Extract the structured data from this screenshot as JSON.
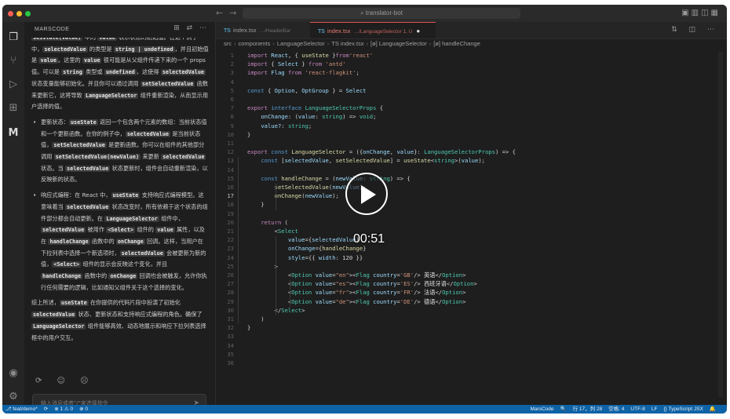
{
  "window": {
    "search_text": "⌕ translator-bot",
    "traffic_lights": [
      "#ff5f57",
      "#febc2e",
      "#28c840"
    ]
  },
  "chat": {
    "panel_title": "MARSCODE",
    "header_icons": "⊞ ⇄ ⋯",
    "paragraphs": {
      "p1": [
        {
          "t": "text",
          "v": ""
        },
        {
          "t": "code",
          "v": "sesstate(value)"
        },
        {
          "t": "text",
          "v": " 中的 "
        },
        {
          "t": "code",
          "v": "value"
        },
        {
          "t": "text",
          "v": " 表示状态的初始值。在这个例子中，"
        },
        {
          "t": "code",
          "v": "selectedValue"
        },
        {
          "t": "text",
          "v": " 的类型是 "
        },
        {
          "t": "code",
          "v": "string | undefined"
        },
        {
          "t": "text",
          "v": "，并且初始值是 "
        },
        {
          "t": "code",
          "v": "value"
        },
        {
          "t": "text",
          "v": "。这里的 "
        },
        {
          "t": "code",
          "v": "value"
        },
        {
          "t": "text",
          "v": " 很可能是从父组件传递下来的一个 props 值。可以是 "
        },
        {
          "t": "code",
          "v": "string"
        },
        {
          "t": "text",
          "v": " 类型或 "
        },
        {
          "t": "code",
          "v": "undefined"
        },
        {
          "t": "text",
          "v": "，这使得 "
        },
        {
          "t": "code",
          "v": "selectedValue"
        },
        {
          "t": "text",
          "v": " 状态变量能够初始化。并且你可以通过调用 "
        },
        {
          "t": "code",
          "v": "setSelectedValue"
        },
        {
          "t": "text",
          "v": " 函数来更新它，这将导致 "
        },
        {
          "t": "code",
          "v": "LanguageSelector"
        },
        {
          "t": "text",
          "v": " 组件重新渲染，从而显示用户选择的值。"
        }
      ],
      "bullet1": [
        {
          "t": "text",
          "v": "更新状态："
        },
        {
          "t": "code",
          "v": "useState"
        },
        {
          "t": "text",
          "v": " 返回一个包含两个元素的数组：当前状态值和一个更新函数。在你的例子中，"
        },
        {
          "t": "code",
          "v": "selectedValue"
        },
        {
          "t": "text",
          "v": " 是当前状态值，"
        },
        {
          "t": "code",
          "v": "setSelectedValue"
        },
        {
          "t": "text",
          "v": " 是更新函数。你可以在组件的其他部分调用 "
        },
        {
          "t": "code",
          "v": "setSelectedValue(newValue)"
        },
        {
          "t": "text",
          "v": " 来更新 "
        },
        {
          "t": "code",
          "v": "selectedValue"
        },
        {
          "t": "text",
          "v": " 状态。当 "
        },
        {
          "t": "code",
          "v": "selectedValue"
        },
        {
          "t": "text",
          "v": " 状态更新时，组件会自动重新渲染，以反映新的状态。"
        }
      ],
      "bullet2": [
        {
          "t": "text",
          "v": "响应式编程：在 React 中，"
        },
        {
          "t": "code",
          "v": "useState"
        },
        {
          "t": "text",
          "v": " 支持响应式编程模型。这意味着当 "
        },
        {
          "t": "code",
          "v": "selectedValue"
        },
        {
          "t": "text",
          "v": " 状态改变时，所有依赖于这个状态的组件部分都会自动更新。在 "
        },
        {
          "t": "code",
          "v": "LanguageSelector"
        },
        {
          "t": "text",
          "v": " 组件中，"
        },
        {
          "t": "code",
          "v": "selectedValue"
        },
        {
          "t": "text",
          "v": " 被用作 "
        },
        {
          "t": "code",
          "v": "<Select>"
        },
        {
          "t": "text",
          "v": " 组件的 "
        },
        {
          "t": "code",
          "v": "value"
        },
        {
          "t": "text",
          "v": " 属性，以及在 "
        },
        {
          "t": "code",
          "v": "handleChange"
        },
        {
          "t": "text",
          "v": " 函数中的 "
        },
        {
          "t": "code",
          "v": "onChange"
        },
        {
          "t": "text",
          "v": " 回调。这样，当用户在下拉列表中选择一个新选项时，"
        },
        {
          "t": "code",
          "v": "selectedValue"
        },
        {
          "t": "text",
          "v": " 会被更新为新的值，"
        },
        {
          "t": "code",
          "v": "<Select>"
        },
        {
          "t": "text",
          "v": " 组件的显示会反映这个变化，并且 "
        },
        {
          "t": "code",
          "v": "handleChange"
        },
        {
          "t": "text",
          "v": " 函数中的 "
        },
        {
          "t": "code",
          "v": "onChange"
        },
        {
          "t": "text",
          "v": " 回调也会被触发，允许你执行任何需要的逻辑，比如通知父组件关于这个选择的变化。"
        }
      ],
      "p2": [
        {
          "t": "text",
          "v": "综上所述，"
        },
        {
          "t": "code",
          "v": "useState"
        },
        {
          "t": "text",
          "v": " 在你提供的代码片段中扮演了初始化 "
        },
        {
          "t": "code",
          "v": "selectedValue"
        },
        {
          "t": "text",
          "v": " 状态、更新状态和支持响应式编程的角色。确保了 "
        },
        {
          "t": "code",
          "v": "LanguageSelector"
        },
        {
          "t": "text",
          "v": " 组件能够高效、动态地展示和响应下拉列表选择框中的用户交互。"
        }
      ]
    },
    "actions": "⟳ ☺ ☹",
    "input_placeholder": "输入消息或者\"/\"来选择指令",
    "send_icon": "➤"
  },
  "editor": {
    "tabs": [
      {
        "ext": "TS",
        "name": "index.tsx",
        "path": "…/HeaderBar",
        "active": false
      },
      {
        "ext": "TS",
        "name": "index.tsx",
        "path": "…/LanguageSelector 1, U",
        "active": true,
        "modified": "●"
      }
    ],
    "tab_icons": "⇅ ◫ ⋯",
    "breadcrumbs": [
      "src",
      "components",
      "LanguageSelector",
      "TS index.tsx",
      "[ø] LanguageSelector",
      "[ø] handleChange"
    ],
    "lines": [
      {
        "n": "1",
        "s": [
          [
            "kw2",
            "import "
          ],
          [
            "va",
            "React"
          ],
          [
            "pu",
            ", { "
          ],
          [
            "fn",
            "useState"
          ],
          [
            "pu",
            " }"
          ],
          [
            "kw2",
            "from"
          ],
          [
            "str",
            "'react'"
          ]
        ]
      },
      {
        "n": "2",
        "s": [
          [
            "kw2",
            "import "
          ],
          [
            "pu",
            "{ "
          ],
          [
            "va",
            "Select"
          ],
          [
            "pu",
            " } "
          ],
          [
            "kw2",
            "from "
          ],
          [
            "str",
            "'antd'"
          ]
        ]
      },
      {
        "n": "3",
        "s": [
          [
            "kw2",
            "import "
          ],
          [
            "va",
            "Flag "
          ],
          [
            "kw2",
            "from "
          ],
          [
            "str",
            "'react-flagkit'"
          ],
          [
            "pu",
            ";"
          ]
        ]
      },
      {
        "n": "4",
        "s": []
      },
      {
        "n": "5",
        "s": [
          [
            "kw",
            "const "
          ],
          [
            "pu",
            "{ "
          ],
          [
            "va",
            "Option"
          ],
          [
            "pu",
            ", "
          ],
          [
            "va",
            "OptGroup"
          ],
          [
            "pu",
            " } = "
          ],
          [
            "va",
            "Select"
          ]
        ]
      },
      {
        "n": "6",
        "s": []
      },
      {
        "n": "7",
        "s": [
          [
            "kw2",
            "export "
          ],
          [
            "kw",
            "interface "
          ],
          [
            "ty",
            "LanguageSelectorProps"
          ],
          [
            "pu",
            " {"
          ]
        ]
      },
      {
        "n": "8",
        "s": [
          [
            "pu",
            "    "
          ],
          [
            "va",
            "onChange"
          ],
          [
            "pu",
            ": ("
          ],
          [
            "va",
            "value"
          ],
          [
            "pu",
            ": "
          ],
          [
            "ty",
            "string"
          ],
          [
            "pu",
            ") => "
          ],
          [
            "ty",
            "void"
          ],
          [
            "pu",
            ";"
          ]
        ]
      },
      {
        "n": "9",
        "s": [
          [
            "pu",
            "    "
          ],
          [
            "va",
            "value?"
          ],
          [
            "pu",
            ": "
          ],
          [
            "ty",
            "string"
          ],
          [
            "pu",
            ";"
          ]
        ]
      },
      {
        "n": "10",
        "s": [
          [
            "pu",
            "}"
          ]
        ]
      },
      {
        "n": "11",
        "s": []
      },
      {
        "n": "12",
        "s": [
          [
            "kw2",
            "export "
          ],
          [
            "kw",
            "const "
          ],
          [
            "fn",
            "LanguageSelector"
          ],
          [
            "pu",
            " = ({"
          ],
          [
            "va",
            "onChange"
          ],
          [
            "pu",
            ", "
          ],
          [
            "va",
            "value"
          ],
          [
            "pu",
            "}: "
          ],
          [
            "ty",
            "LanguageSelectorProps"
          ],
          [
            "pu",
            ") => {"
          ]
        ]
      },
      {
        "n": "13",
        "s": [
          [
            "pu",
            "    "
          ],
          [
            "kw",
            "const "
          ],
          [
            "pu",
            "["
          ],
          [
            "va",
            "selectedValue"
          ],
          [
            "pu",
            ", "
          ],
          [
            "fn",
            "setSelectedValue"
          ],
          [
            "pu",
            "] = "
          ],
          [
            "fn",
            "useState"
          ],
          [
            "pu",
            "<"
          ],
          [
            "ty",
            "string"
          ],
          [
            "pu",
            ">("
          ],
          [
            "va",
            "value"
          ],
          [
            "pu",
            ");"
          ]
        ]
      },
      {
        "n": "14",
        "s": []
      },
      {
        "n": "15",
        "s": [
          [
            "pu",
            "    "
          ],
          [
            "kw",
            "const "
          ],
          [
            "fn",
            "handleChange"
          ],
          [
            "pu",
            " = ("
          ],
          [
            "va",
            "newValue"
          ],
          [
            "pu",
            ": "
          ],
          [
            "ty",
            "string"
          ],
          [
            "pu",
            ") => {"
          ]
        ]
      },
      {
        "n": "16",
        "s": [
          [
            "pu",
            "        "
          ],
          [
            "fn",
            "setSelectedValue"
          ],
          [
            "pu",
            "("
          ],
          [
            "va",
            "newValue"
          ],
          [
            "pu",
            ");"
          ]
        ]
      },
      {
        "n": "17",
        "s": [
          [
            "pu",
            "        "
          ],
          [
            "fn",
            "onChange"
          ],
          [
            "pu",
            "("
          ],
          [
            "va",
            "newValue"
          ],
          [
            "pu",
            ");"
          ]
        ]
      },
      {
        "n": "18",
        "s": [
          [
            "pu",
            "    }"
          ]
        ]
      },
      {
        "n": "19",
        "s": []
      },
      {
        "n": "20",
        "s": [
          [
            "pu",
            "    "
          ],
          [
            "kw2",
            "return "
          ],
          [
            "pu",
            "("
          ]
        ]
      },
      {
        "n": "21",
        "s": [
          [
            "pu",
            "        <"
          ],
          [
            "ty",
            "Select"
          ]
        ]
      },
      {
        "n": "22",
        "s": [
          [
            "pu",
            "            "
          ],
          [
            "at",
            "value"
          ],
          [
            "pu",
            "={"
          ],
          [
            "va",
            "selectedValue"
          ],
          [
            "pu",
            "}"
          ]
        ]
      },
      {
        "n": "23",
        "s": [
          [
            "pu",
            "            "
          ],
          [
            "at",
            "onChange"
          ],
          [
            "pu",
            "={"
          ],
          [
            "fn",
            "handleChange"
          ],
          [
            "pu",
            "}"
          ]
        ]
      },
      {
        "n": "24",
        "s": [
          [
            "pu",
            "            "
          ],
          [
            "at",
            "style"
          ],
          [
            "pu",
            "={{ "
          ],
          [
            "va",
            "width"
          ],
          [
            "pu",
            ": 120 }}"
          ]
        ]
      },
      {
        "n": "25",
        "s": [
          [
            "pu",
            "        >"
          ]
        ]
      },
      {
        "n": "26",
        "s": [
          [
            "pu",
            "            <"
          ],
          [
            "ty",
            "Option "
          ],
          [
            "at",
            "value"
          ],
          [
            "pu",
            "="
          ],
          [
            "str",
            "\"en\""
          ],
          [
            "pu",
            "><"
          ],
          [
            "ty",
            "Flag "
          ],
          [
            "at",
            "country"
          ],
          [
            "pu",
            "="
          ],
          [
            "str",
            "'GB'"
          ],
          [
            "pu",
            "/> "
          ],
          [
            "cm",
            "英语"
          ],
          [
            "pu",
            "</"
          ],
          [
            "ty",
            "Option"
          ],
          [
            "pu",
            ">"
          ]
        ]
      },
      {
        "n": "27",
        "s": [
          [
            "pu",
            "            <"
          ],
          [
            "ty",
            "Option "
          ],
          [
            "at",
            "value"
          ],
          [
            "pu",
            "="
          ],
          [
            "str",
            "\"es\""
          ],
          [
            "pu",
            "><"
          ],
          [
            "ty",
            "Flag "
          ],
          [
            "at",
            "country"
          ],
          [
            "pu",
            "="
          ],
          [
            "str",
            "'ES'"
          ],
          [
            "pu",
            "/> "
          ],
          [
            "cm",
            "西班牙语"
          ],
          [
            "pu",
            "</"
          ],
          [
            "ty",
            "Option"
          ],
          [
            "pu",
            ">"
          ]
        ]
      },
      {
        "n": "28",
        "s": [
          [
            "pu",
            "            <"
          ],
          [
            "ty",
            "Option "
          ],
          [
            "at",
            "value"
          ],
          [
            "pu",
            "="
          ],
          [
            "str",
            "\"fr\""
          ],
          [
            "pu",
            "><"
          ],
          [
            "ty",
            "Flag "
          ],
          [
            "at",
            "country"
          ],
          [
            "pu",
            "="
          ],
          [
            "str",
            "'FR'"
          ],
          [
            "pu",
            "/> "
          ],
          [
            "cm",
            "法语"
          ],
          [
            "pu",
            "</"
          ],
          [
            "ty",
            "Option"
          ],
          [
            "pu",
            ">"
          ]
        ]
      },
      {
        "n": "29",
        "s": [
          [
            "pu",
            "            <"
          ],
          [
            "ty",
            "Option "
          ],
          [
            "at",
            "value"
          ],
          [
            "pu",
            "="
          ],
          [
            "str",
            "\"de\""
          ],
          [
            "pu",
            "><"
          ],
          [
            "ty",
            "Flag "
          ],
          [
            "at",
            "country"
          ],
          [
            "pu",
            "="
          ],
          [
            "str",
            "'DE'"
          ],
          [
            "pu",
            "/> "
          ],
          [
            "cm",
            "德语"
          ],
          [
            "pu",
            "</"
          ],
          [
            "ty",
            "Option"
          ],
          [
            "pu",
            ">"
          ]
        ]
      },
      {
        "n": "30",
        "s": [
          [
            "pu",
            "        </"
          ],
          [
            "ty",
            "Select"
          ],
          [
            "pu",
            ">"
          ]
        ]
      },
      {
        "n": "31",
        "s": [
          [
            "pu",
            "    )"
          ]
        ]
      },
      {
        "n": "32",
        "s": [
          [
            "pu",
            "}"
          ]
        ]
      },
      {
        "n": "33",
        "s": []
      },
      {
        "n": "34",
        "s": []
      },
      {
        "n": "35",
        "s": []
      },
      {
        "n": "36",
        "s": []
      }
    ]
  },
  "video": {
    "timecode": "00:51"
  },
  "statusbar": {
    "left": [
      "⎇ feat/demo*",
      "⟳",
      "⊗ 1 ⚠ 0",
      "⊗ 0"
    ],
    "right": [
      "MarsCode",
      "🔍",
      "行 17，列 28",
      "空格: 4",
      "UTF-8",
      "LF",
      "{} TypeScript JSX",
      "🔔"
    ]
  },
  "colors": {
    "statusbar_bg": "#0e62a6",
    "active_tab_accent": "#e05555",
    "editor_bg": "#1e1e1e"
  }
}
